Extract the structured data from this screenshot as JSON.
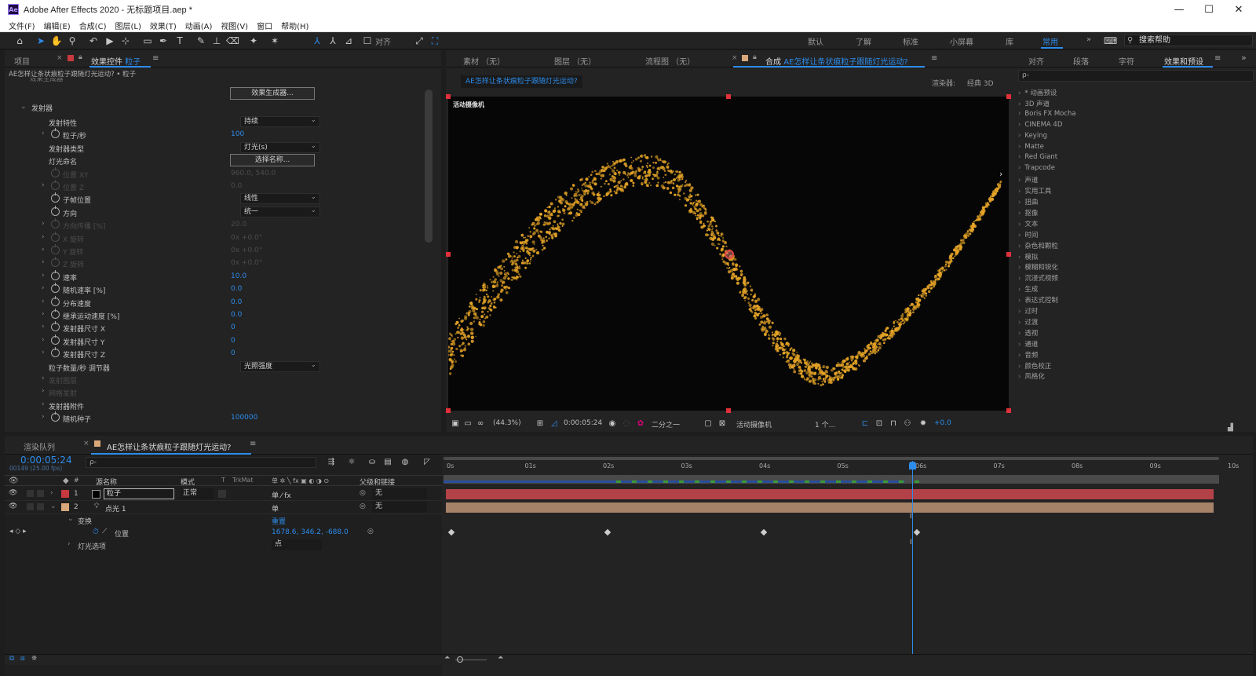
{
  "window": {
    "title": "Adobe After Effects 2020 - 无标题项目.aep *",
    "logo": "Ae",
    "minimize": "—",
    "maximize": "☐",
    "close": "✕"
  },
  "menu": [
    "文件(F)",
    "编辑(E)",
    "合成(C)",
    "图层(L)",
    "效果(T)",
    "动画(A)",
    "视图(V)",
    "窗口",
    "帮助(H)"
  ],
  "toolbar": {
    "align_label": "对齐",
    "workspaces": [
      "默认",
      "了解",
      "标准",
      "小屏幕",
      "库",
      "常用"
    ],
    "active_workspace": "常用",
    "more": "»",
    "help_search": "搜索帮助"
  },
  "left_panel": {
    "tabs": [
      "项目",
      "效果控件 粒子"
    ],
    "tab_prefix": "效果控件",
    "tab_layer": "粒子",
    "breadcrumb": "AE怎样让条状痕粒子跟随灯光运动? • 粒子",
    "cut_top_label": "效果生成器",
    "effect_builder_button": "效果生成器...",
    "emitter_group": "发射器",
    "rows": [
      {
        "label": "发射特性",
        "kind": "dropdown",
        "value": "持续"
      },
      {
        "label": "粒子/秒",
        "kind": "value",
        "value": "100",
        "stopwatch": true,
        "arrow": true
      },
      {
        "label": "发射器类型",
        "kind": "dropdown",
        "value": "灯光(s)"
      },
      {
        "label": "灯光命名",
        "kind": "button",
        "value": "选择名称..."
      },
      {
        "label": "位置 XY",
        "kind": "value",
        "value": "960.0, 540.0",
        "stopwatch": true,
        "dim": true
      },
      {
        "label": "位置 Z",
        "kind": "value",
        "value": "0.0",
        "stopwatch": true,
        "arrow": true,
        "dim": true
      },
      {
        "label": "子帧位置",
        "kind": "dropdown",
        "value": "线性",
        "stopwatch": true
      },
      {
        "label": "方向",
        "kind": "dropdown",
        "value": "统一",
        "stopwatch": true
      },
      {
        "label": "方向传播 [%]",
        "kind": "value",
        "value": "20.0",
        "stopwatch": true,
        "arrow": true,
        "dim": true
      },
      {
        "label": "X 旋转",
        "kind": "value",
        "value": "0x +0.0°",
        "stopwatch": true,
        "arrow": true,
        "dim": true
      },
      {
        "label": "Y 旋转",
        "kind": "value",
        "value": "0x +0.0°",
        "stopwatch": true,
        "arrow": true,
        "dim": true
      },
      {
        "label": "Z 旋转",
        "kind": "value",
        "value": "0x +0.0°",
        "stopwatch": true,
        "arrow": true,
        "dim": true
      },
      {
        "label": "速率",
        "kind": "value",
        "value": "10.0",
        "stopwatch": true,
        "arrow": true
      },
      {
        "label": "随机速率 [%]",
        "kind": "value",
        "value": "0.0",
        "stopwatch": true,
        "arrow": true
      },
      {
        "label": "分布速度",
        "kind": "value",
        "value": "0.0",
        "stopwatch": true,
        "arrow": true
      },
      {
        "label": "继承运动速度 [%]",
        "kind": "value",
        "value": "0.0",
        "stopwatch": true,
        "arrow": true
      },
      {
        "label": "发射器尺寸 X",
        "kind": "value",
        "value": "0",
        "stopwatch": true,
        "arrow": true
      },
      {
        "label": "发射器尺寸 Y",
        "kind": "value",
        "value": "0",
        "stopwatch": true,
        "arrow": true
      },
      {
        "label": "发射器尺寸 Z",
        "kind": "value",
        "value": "0",
        "stopwatch": true,
        "arrow": true
      },
      {
        "label": "粒子数量/秒 调节器",
        "kind": "dropdown",
        "value": "光照强度"
      },
      {
        "label": "发射图层",
        "kind": "none",
        "value": "",
        "arrow": true,
        "dim": true
      },
      {
        "label": "网格发射",
        "kind": "none",
        "value": "",
        "arrow": true,
        "dim": true
      },
      {
        "label": "发射器附件",
        "kind": "none",
        "value": "",
        "arrow": true
      },
      {
        "label": "随机种子",
        "kind": "value",
        "value": "100000",
        "stopwatch": true,
        "arrow": true
      }
    ]
  },
  "viewer": {
    "tabs": [
      "素材 （无）",
      "图层 （无）",
      "流程图 （无）"
    ],
    "comp_prefix": "合成",
    "comp_name": "AE怎样让条状痕粒子跟随灯光运动?",
    "comp_tab": "AE怎样让条状痕粒子跟随灯光运动?",
    "renderer_label": "渲染器:",
    "renderer_value": "经典 3D",
    "camera_overlay": "活动摄像机",
    "zoom": "(44.3%)",
    "timecode": "0:00:05:24",
    "resolution": "二分之一",
    "camera": "活动摄像机",
    "views": "1 个...",
    "exposure": "+0.0",
    "particle_color": "#e5a427"
  },
  "effects_panel": {
    "tabs": [
      "对齐",
      "段落",
      "字符",
      "效果和预设"
    ],
    "search_placeholder": "ρ-",
    "items": [
      "* 动画预设",
      "3D 声道",
      "Boris FX Mocha",
      "CINEMA 4D",
      "Keying",
      "Matte",
      "Red Giant",
      "Trapcode",
      "声道",
      "实用工具",
      "扭曲",
      "抠像",
      "文本",
      "时间",
      "杂色和颗粒",
      "模拟",
      "模糊和锐化",
      "沉浸式视频",
      "生成",
      "表达式控制",
      "过时",
      "过渡",
      "透视",
      "通道",
      "音频",
      "颜色校正",
      "风格化"
    ]
  },
  "timeline": {
    "render_queue_tab": "渲染队列",
    "comp_tab": "AE怎样让条状痕粒子跟随灯光运动?",
    "timecode": "0:00:05:24",
    "frame_info": "00149 (25.00 fps)",
    "search_placeholder": "ρ-",
    "columns": {
      "source": "源名称",
      "mode": "模式",
      "t": "T",
      "trkmat": "TrkMat",
      "parent": "父级和链接"
    },
    "switch_symbols": "单 ✲ ╲ fx ▣ ◐ ◑ ⊙",
    "ruler": [
      "0s",
      "01s",
      "02s",
      "03s",
      "04s",
      "05s",
      "06s",
      "07s",
      "08s",
      "09s",
      "10s"
    ],
    "playhead_seconds": 5.96,
    "duration_seconds": 10,
    "layers": [
      {
        "num": "1",
        "name": "粒子",
        "mode": "正常",
        "parent": "无",
        "color": "#c8393f",
        "bar_color": "#b34148",
        "swatch_switch": "单 ⁄ fx"
      },
      {
        "num": "2",
        "name": "点光 1",
        "mode": "",
        "parent": "无",
        "color": "#d9a77a",
        "bar_color": "#a58268",
        "swatch_switch": "单"
      }
    ],
    "transform_label": "变换",
    "reset_label": "重置",
    "position_label": "位置",
    "position_value": "1678.6, 346.2, -688.0",
    "light_options_label": "灯光选项",
    "light_options_value": "点",
    "keyframe_seconds": [
      0,
      2,
      4,
      5.96
    ]
  }
}
